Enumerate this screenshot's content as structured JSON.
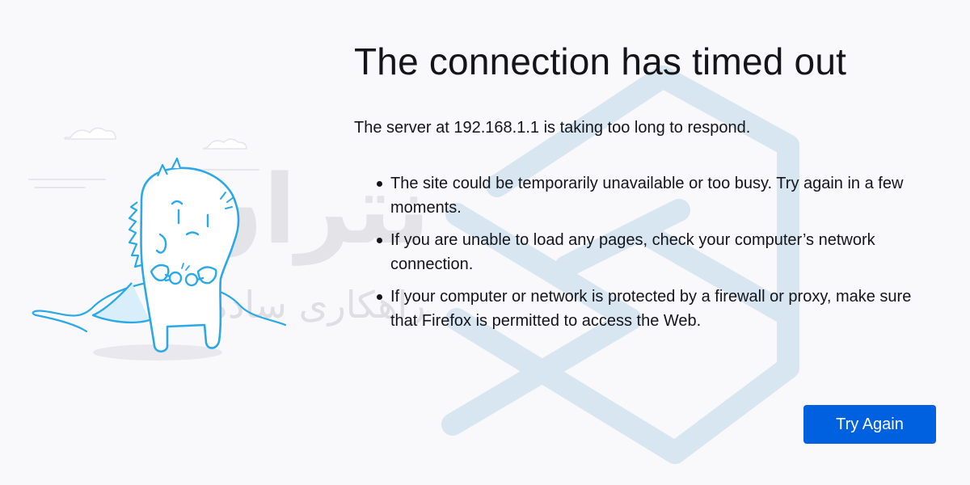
{
  "page": {
    "title": "The connection has timed out",
    "subtitle": "The server at 192.168.1.1 is taking too long to respond.",
    "reasons": [
      {
        "text": "The site could be temporarily unavailable or too busy. Try again in a few moments."
      },
      {
        "text": "If you are unable to load any pages, check your computer’s network connection."
      },
      {
        "text": "If your computer or network is protected by a firewall or proxy, make sure that Firefox is permitted to access the Web."
      }
    ],
    "try_again_label": "Try Again"
  },
  "watermark": {
    "primary": "نتران",
    "secondary": "راهکاری ساده تر"
  },
  "illustration": {
    "icon": "dino-unplugged-illustration"
  },
  "colors": {
    "background": "#f9f9fb",
    "text": "#15141a",
    "accent": "#0061e0",
    "illustration_stroke": "#2ba8e8",
    "illustration_fill": "#ffffff",
    "watermark_logo": "#d7e6f0"
  }
}
